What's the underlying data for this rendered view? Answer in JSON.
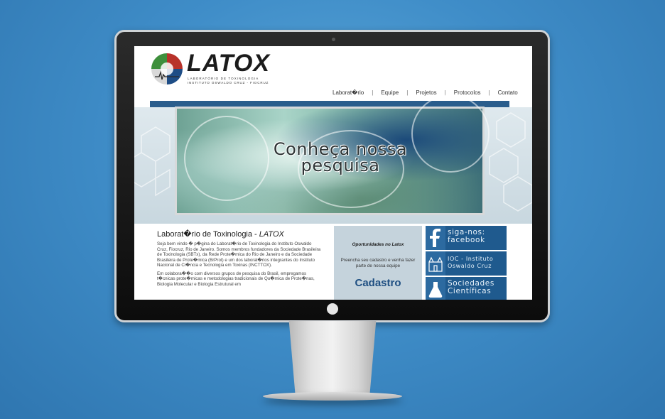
{
  "brand": {
    "name": "LATOX",
    "subtitle_line1": "LABORATÓRIO DE TOXINOLOGIA",
    "subtitle_line2": "INSTITUTO OSWALDO CRUZ - FIOCRUZ"
  },
  "nav": {
    "items": [
      "Laborat�rio",
      "Equipe",
      "Projetos",
      "Protocolos",
      "Contato"
    ],
    "separator": "|"
  },
  "banner": {
    "headline_line1": "Conheça nossa",
    "headline_line2": "pesquisa"
  },
  "intro": {
    "title": "Laborat�rio de Toxinologia - ",
    "title_brand": "LATOX",
    "paragraph1": "Seja bem vindo � p�gina do Laborat�rio de Toxinologia do Instituto Oswaldo Cruz, Fiocruz, Rio de Janeiro. Somos membros fundadores da Sociedade Brasileira de Toxinologia (SBTx), da Rede Prote�mica do Rio de Janeiro e da Sociedade Brasileira de Prote�mica (BrProt) e um dos laborat�rios integrantes do Instituto Nacional de Ci�ncia e Tecnologia em Toxinas (INCTTOX).",
    "paragraph2": "Em colabora��o com diversos grupos de pesquisa do Brasil, empregamos t�cnicas prote�micas e metodologias tradicionais de Qu�mica de Prote�nas, Biologia Molecular e Biologia Estrutural em"
  },
  "opportunities": {
    "title": "Oportunidades no Latox",
    "text": "Preencha seu cadastro e venha fazer parte de nossa equipe",
    "button": "Cadastro"
  },
  "side_links": [
    {
      "icon": "facebook-icon",
      "line1": "siga-nos:",
      "line2": "facebook"
    },
    {
      "icon": "building-icon",
      "line1": "IOC - Instituto",
      "line2": "Oswaldo Cruz"
    },
    {
      "icon": "flask-icon",
      "line1": "Sociedades",
      "line2": "Científicas"
    }
  ],
  "colors": {
    "background": "#3f8dc8",
    "nav_strip": "#2a5d8c",
    "side_panel": "#1f5a8e",
    "opp_box": "#c5d3dc",
    "cadastro": "#1f4f82"
  }
}
